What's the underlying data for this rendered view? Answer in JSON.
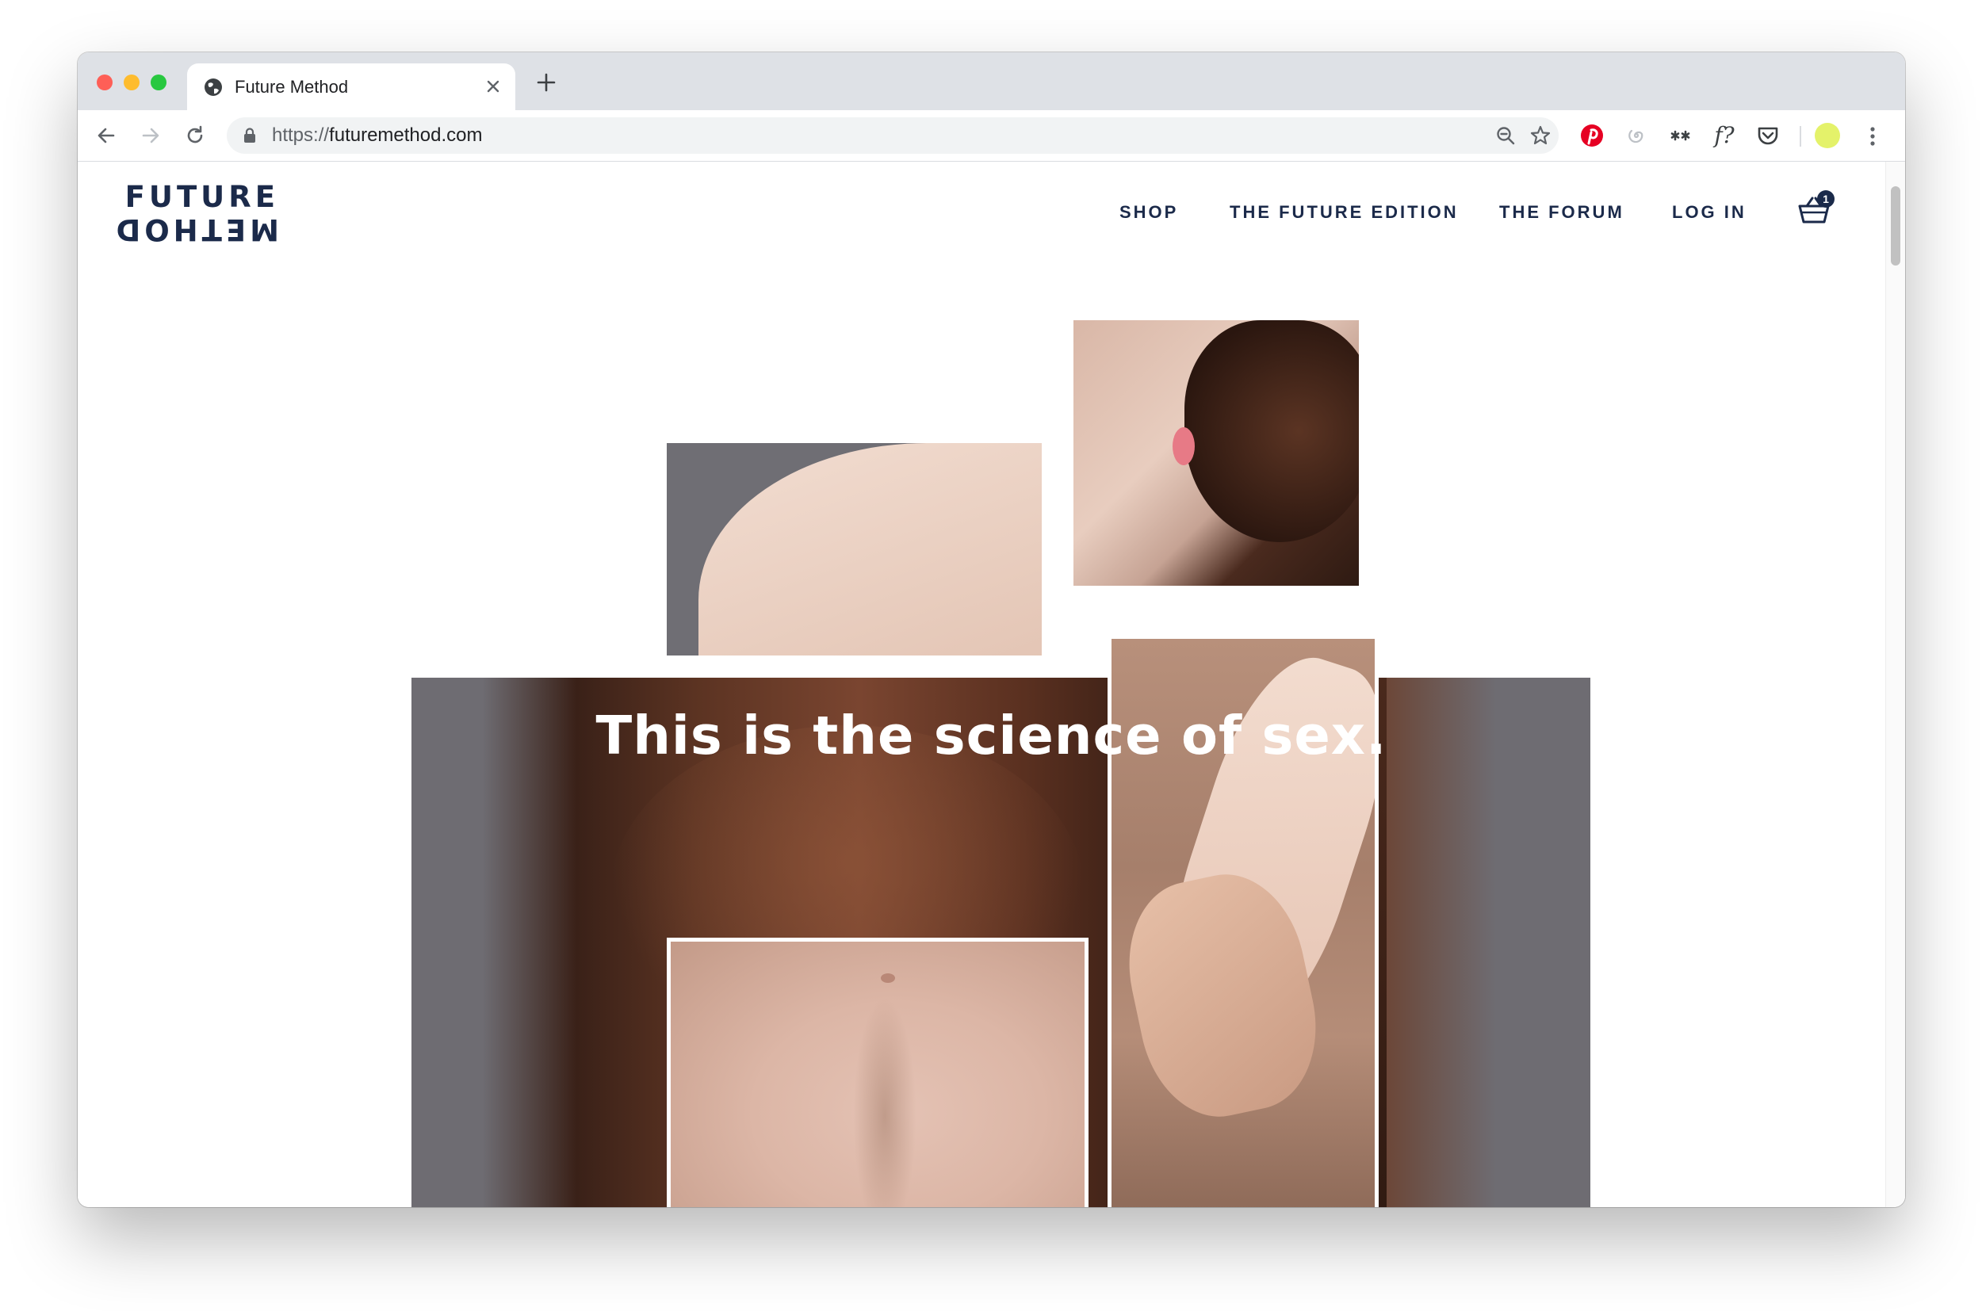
{
  "browser": {
    "tab_title": "Future Method",
    "url_scheme": "https://",
    "url_host": "futuremethod.com",
    "profile_color": "#e4f26a"
  },
  "site": {
    "logo_top": "FUTURE",
    "logo_bottom": "METHOD",
    "nav": [
      "SHOP",
      "THE FUTURE EDITION",
      "THE FORUM",
      "LOG IN"
    ],
    "cart_count": "1",
    "hero_headline": "This is the science of sex.",
    "brand_color": "#1b2a4a"
  }
}
